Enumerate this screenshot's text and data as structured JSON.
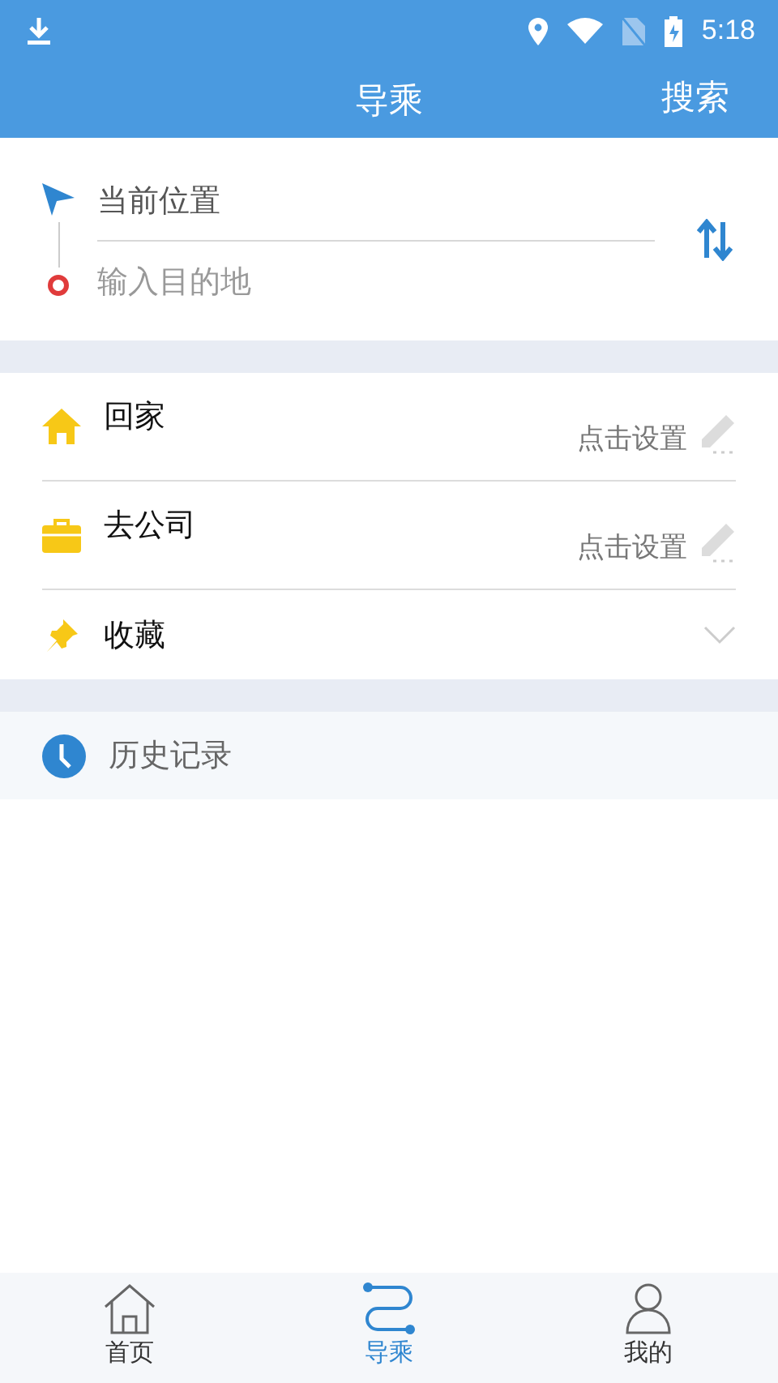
{
  "status_bar": {
    "time": "5:18"
  },
  "header": {
    "title": "导乘",
    "action": "搜索"
  },
  "route": {
    "origin": "当前位置",
    "destination_placeholder": "输入目的地"
  },
  "shortcuts": [
    {
      "kind": "home",
      "label": "回家",
      "action": "点击设置"
    },
    {
      "kind": "work",
      "label": "去公司",
      "action": "点击设置"
    },
    {
      "kind": "favorites",
      "label": "收藏",
      "expanded": false
    }
  ],
  "history": {
    "label": "历史记录"
  },
  "tabs": [
    {
      "kind": "home",
      "label": "首页",
      "selected": false
    },
    {
      "kind": "route",
      "label": "导乘",
      "selected": true
    },
    {
      "kind": "profile",
      "label": "我的",
      "selected": false
    }
  ]
}
